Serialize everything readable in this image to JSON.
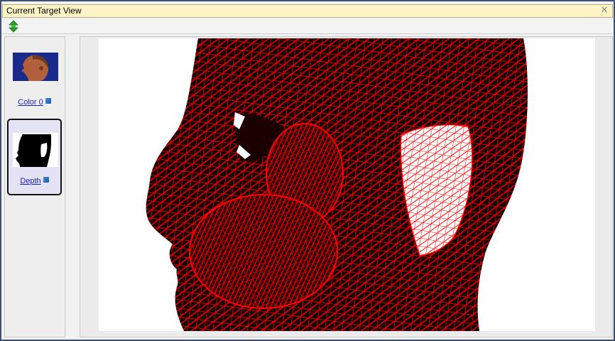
{
  "window": {
    "title": "Current Target View",
    "close_icon": "close-icon"
  },
  "toolbar": {
    "buttons": [
      {
        "icon": "expand-collapse-icon",
        "color": "#2aa12a"
      }
    ]
  },
  "sidebar": {
    "items": [
      {
        "label": "Color 0",
        "thumbnail": "color-head-thumbnail",
        "selected": false
      },
      {
        "label": "Depth",
        "thumbnail": "depth-mask-thumbnail",
        "selected": true
      }
    ]
  },
  "viewport": {
    "content": "wireframe-head-render",
    "mesh_color": "#ff0000",
    "background_color": "#ffffff"
  }
}
